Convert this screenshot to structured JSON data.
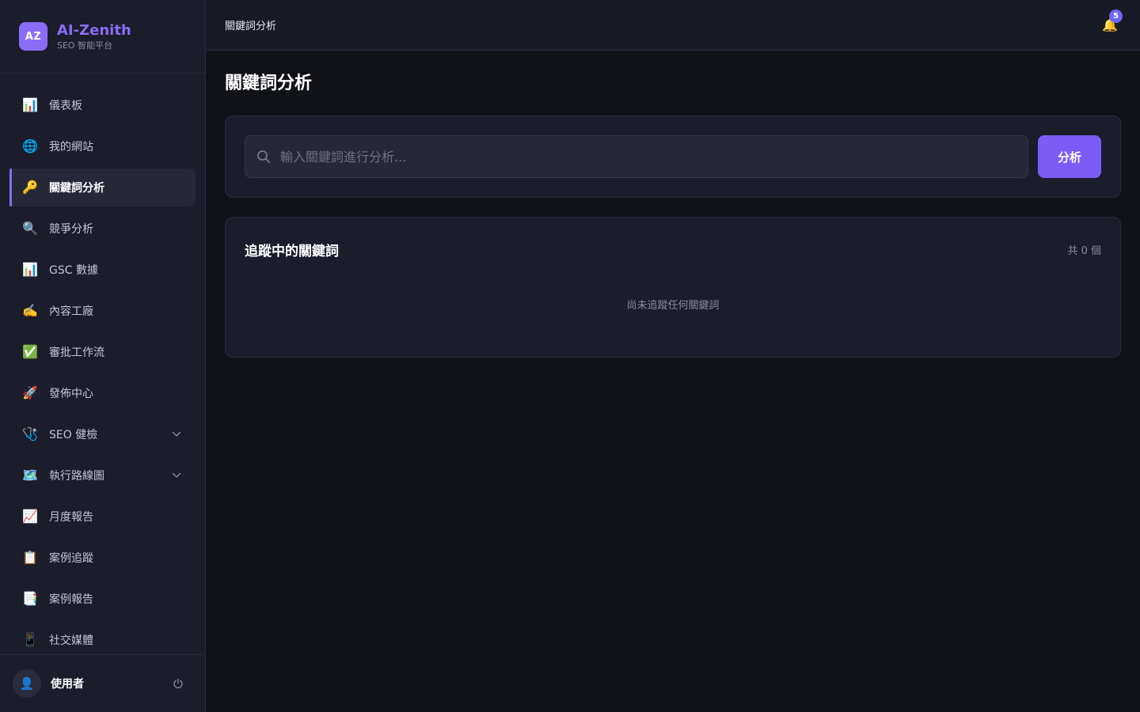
{
  "brand": {
    "logo_text": "AZ",
    "name": "AI-Zenith",
    "subtitle": "SEO 智能平台"
  },
  "sidebar": {
    "items": [
      {
        "label": "儀表板",
        "icon": "📊",
        "icon_name": "bar-chart-icon"
      },
      {
        "label": "我的網站",
        "icon": "🌐",
        "icon_name": "globe-icon"
      },
      {
        "label": "關鍵詞分析",
        "icon": "🔑",
        "icon_name": "key-icon",
        "active": true
      },
      {
        "label": "競爭分析",
        "icon": "🔍",
        "icon_name": "magnifier-icon"
      },
      {
        "label": "GSC 數據",
        "icon": "📊",
        "icon_name": "bar-chart-icon"
      },
      {
        "label": "內容工廠",
        "icon": "✍️",
        "icon_name": "writing-hand-icon"
      },
      {
        "label": "審批工作流",
        "icon": "✅",
        "icon_name": "check-mark-icon"
      },
      {
        "label": "發佈中心",
        "icon": "🚀",
        "icon_name": "rocket-icon"
      },
      {
        "label": "SEO 健檢",
        "icon": "🩺",
        "icon_name": "stethoscope-icon",
        "expandable": true
      },
      {
        "label": "執行路線圖",
        "icon": "🗺️",
        "icon_name": "map-icon",
        "expandable": true
      },
      {
        "label": "月度報告",
        "icon": "📈",
        "icon_name": "trending-chart-icon"
      },
      {
        "label": "案例追蹤",
        "icon": "📋",
        "icon_name": "clipboard-icon"
      },
      {
        "label": "案例報告",
        "icon": "📑",
        "icon_name": "bookmark-tabs-icon"
      },
      {
        "label": "社交媒體",
        "icon": "📱",
        "icon_name": "mobile-phone-icon"
      }
    ]
  },
  "user": {
    "avatar": "👤",
    "name": "使用者"
  },
  "topbar": {
    "breadcrumb": "關鍵詞分析",
    "notification_count": "5",
    "bell": "🔔"
  },
  "main": {
    "page_title": "關鍵詞分析",
    "search": {
      "placeholder": "輸入關鍵詞進行分析...",
      "value": ""
    },
    "analyze_label": "分析",
    "tracked": {
      "title": "追蹤中的關鍵詞",
      "count_label": "共 0 個",
      "empty_text": "尚未追蹤任何關鍵詞"
    }
  },
  "colors": {
    "accent": "#7c5cf6",
    "brand": "#8b6cf6",
    "background": "#111218",
    "sidebar": "#1b1d2b",
    "badge": "#6e66f5"
  }
}
